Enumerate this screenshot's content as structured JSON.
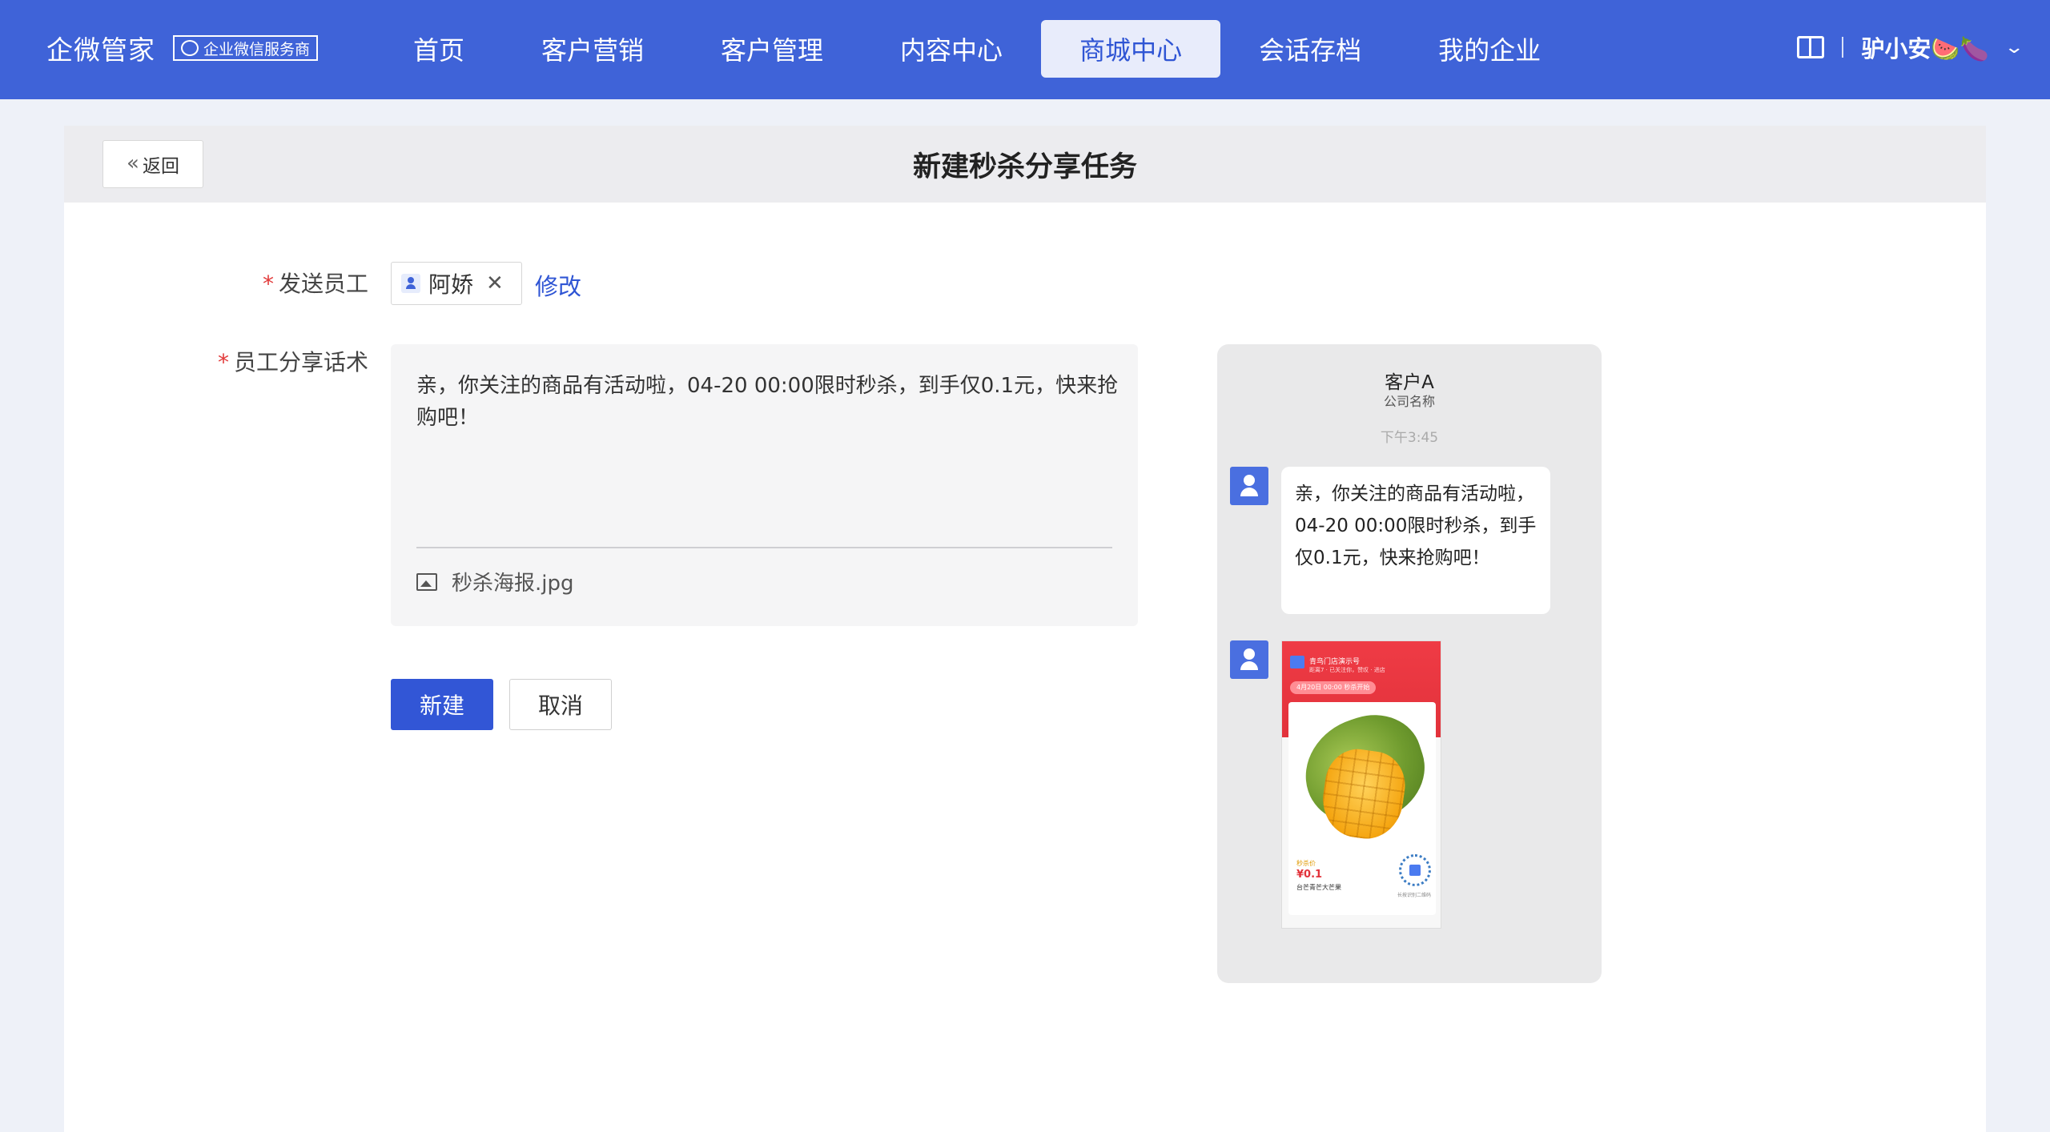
{
  "topbar": {
    "brand_name": "企微管家",
    "brand_badge": "企业微信服务商",
    "nav": [
      {
        "label": "首页",
        "active": false
      },
      {
        "label": "客户营销",
        "active": false
      },
      {
        "label": "客户管理",
        "active": false
      },
      {
        "label": "内容中心",
        "active": false
      },
      {
        "label": "商城中心",
        "active": true
      },
      {
        "label": "会话存档",
        "active": false
      },
      {
        "label": "我的企业",
        "active": false
      }
    ],
    "user_name": "驴小安🍉🍆",
    "icons": [
      "book-icon",
      "chevron-down-icon"
    ]
  },
  "header": {
    "back_label": "返回",
    "title": "新建秒杀分享任务"
  },
  "form": {
    "staff_label": "发送员工",
    "staff_name": "阿娇",
    "modify_label": "修改",
    "script_label": "员工分享话术",
    "script_text": "亲，你关注的商品有活动啦，04-20 00:00限时秒杀，到手仅0.1元，快来抢购吧！",
    "attachment_name": "秒杀海报.jpg",
    "submit_label": "新建",
    "cancel_label": "取消"
  },
  "preview": {
    "customer_name": "客户A",
    "company": "公司名称",
    "time": "下午3:45",
    "message": "亲，你关注的商品有活动啦，04-20 00:00限时秒杀，到手仅0.1元，快来抢购吧！",
    "poster": {
      "shop": "青鸟门店演示号",
      "sub": "距离7 · 已关注你，赞叹 · 进店",
      "pill": "4月20日 00:00 秒杀开始",
      "label": "秒杀价",
      "price": "¥0.1",
      "product": "台芒青芒大芒果",
      "qr_caption": "长按识别二维码"
    }
  },
  "colors": {
    "brand_blue": "#3f63d8",
    "primary_button": "#3256d6",
    "required": "#e23b3b"
  }
}
